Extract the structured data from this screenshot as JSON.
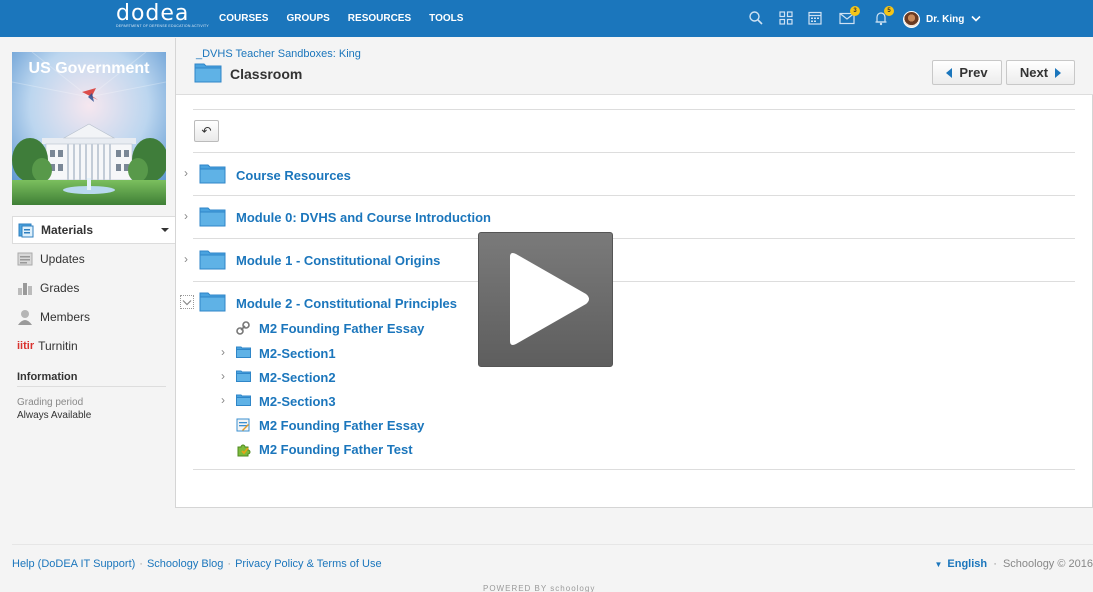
{
  "topbar": {
    "logo_text": "dodea",
    "logo_tagline": "DEPARTMENT OF DEFENSE EDUCATION ACTIVITY",
    "nav": [
      "COURSES",
      "GROUPS",
      "RESOURCES",
      "TOOLS"
    ],
    "message_badge": "3",
    "notification_badge": "5",
    "user_name": "Dr. King"
  },
  "course": {
    "image_title": "US Government"
  },
  "sidebar": {
    "items": [
      {
        "label": "Materials",
        "icon": "materials-icon",
        "active": true
      },
      {
        "label": "Updates",
        "icon": "updates-icon"
      },
      {
        "label": "Grades",
        "icon": "grades-icon"
      },
      {
        "label": "Members",
        "icon": "members-icon"
      },
      {
        "label": "Turnitin",
        "icon": "turnitin-icon"
      }
    ],
    "turnitin_mark": "iitir",
    "info_heading": "Information",
    "grading_label": "Grading period",
    "grading_value": "Always Available"
  },
  "main": {
    "breadcrumb": "_DVHS Teacher Sandboxes: King",
    "title": "Classroom",
    "prev_label": "Prev",
    "next_label": "Next",
    "back_label": "↶",
    "folders": [
      {
        "label": "Course Resources"
      },
      {
        "label": "Module 0: DVHS and Course Introduction"
      },
      {
        "label": "Module 1 - Constitutional Origins"
      },
      {
        "label": "Module 2 - Constitutional Principles"
      }
    ],
    "module2_items": [
      {
        "label": "M2 Founding Father Essay",
        "type": "link"
      },
      {
        "label": "M2-Section1",
        "type": "folder"
      },
      {
        "label": "M2-Section2",
        "type": "folder"
      },
      {
        "label": "M2-Section3",
        "type": "folder"
      },
      {
        "label": "M2 Founding Father Essay",
        "type": "assignment"
      },
      {
        "label": "M2 Founding Father Test",
        "type": "test"
      }
    ]
  },
  "footer": {
    "links": [
      "Help (DoDEA IT Support)",
      "Schoology Blog",
      "Privacy Policy & Terms of Use"
    ],
    "language": "English",
    "copyright": "Schoology © 2016",
    "powered": "POWERED BY schoology"
  },
  "colors": {
    "brand_blue": "#1b76bc",
    "link_blue": "#1b76bc",
    "folder_blue": "#4aa3df",
    "badge_yellow": "#f5c518"
  }
}
